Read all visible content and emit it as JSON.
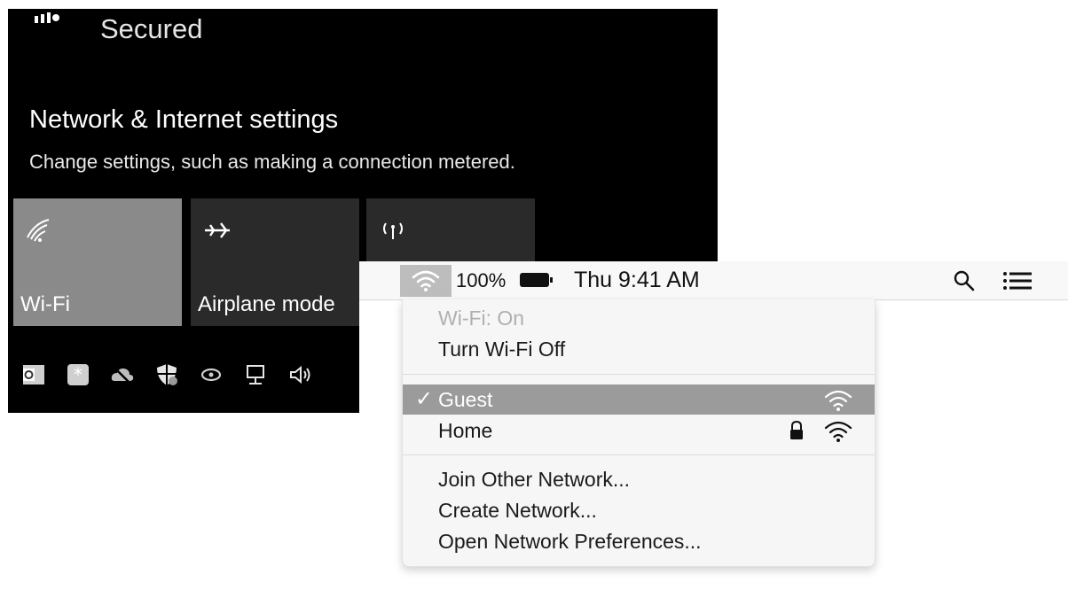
{
  "windows": {
    "status_text": "Secured",
    "settings_title": "Network & Internet settings",
    "settings_subtitle": "Change settings, such as making a connection metered.",
    "tiles": [
      {
        "label": "Wi-Fi",
        "icon": "wifi-icon",
        "active": true
      },
      {
        "label": "Airplane mode",
        "icon": "airplane-icon",
        "active": false
      },
      {
        "label": "",
        "icon": "mobile-hotspot-icon",
        "active": false
      }
    ],
    "tray_icons": [
      "outlook-icon",
      "asterisk-app-icon",
      "cloud-offline-icon",
      "security-shield-icon",
      "nvidia-icon",
      "network-icon",
      "volume-icon"
    ]
  },
  "mac": {
    "menubar": {
      "battery_percent": "100%",
      "clock": "Thu 9:41 AM",
      "icons": [
        "wifi-icon",
        "battery-icon",
        "spotlight-search-icon",
        "notification-list-icon"
      ]
    },
    "wifi_menu": {
      "status": "Wi-Fi: On",
      "toggle_label": "Turn Wi-Fi Off",
      "networks": [
        {
          "name": "Guest",
          "selected": true,
          "check": "✓",
          "secured": false
        },
        {
          "name": "Home",
          "selected": false,
          "secured": true
        }
      ],
      "actions": [
        "Join Other Network...",
        "Create Network...",
        "Open Network Preferences..."
      ]
    }
  },
  "colors": {
    "windows_bg": "#000000",
    "tile_active": "#8a8a8a",
    "tile_inactive": "#2a2a2a",
    "menu_bg": "#f6f6f6",
    "menu_selected": "#9b9b9b"
  }
}
